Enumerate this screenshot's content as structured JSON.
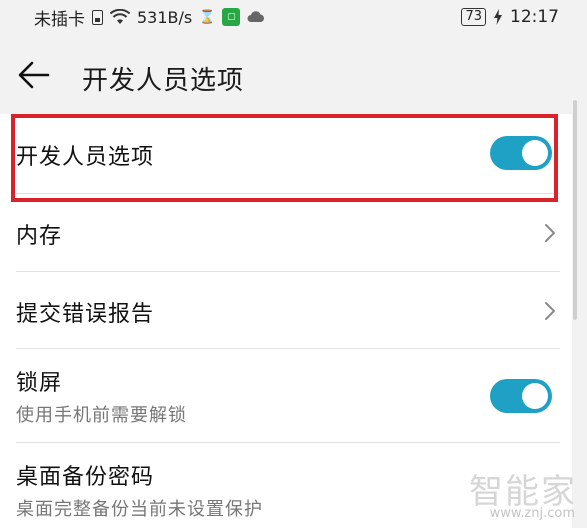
{
  "status_bar": {
    "carrier": "未插卡",
    "speed": "531B/s",
    "battery": "73",
    "time": "12:17",
    "icons": [
      "sim-icon",
      "wifi-icon",
      "hourglass-icon",
      "app-badge-icon",
      "cloud-icon",
      "charge-icon"
    ]
  },
  "header": {
    "back_icon": "arrow-left-icon",
    "title": "开发人员选项"
  },
  "settings": {
    "developer_options": {
      "label": "开发人员选项",
      "enabled": true
    },
    "memory": {
      "label": "内存"
    },
    "bug_report": {
      "label": "提交错误报告"
    },
    "lock_screen": {
      "label": "锁屏",
      "subtitle": "使用手机前需要解锁",
      "enabled": true
    },
    "backup_password": {
      "label": "桌面备份密码",
      "subtitle": "桌面完整备份当前未设置保护"
    }
  },
  "watermark": {
    "text": "智能家",
    "url": "www.znj.com"
  },
  "colors": {
    "toggle_on": "#1fa0c5",
    "highlight": "#d8232a"
  }
}
